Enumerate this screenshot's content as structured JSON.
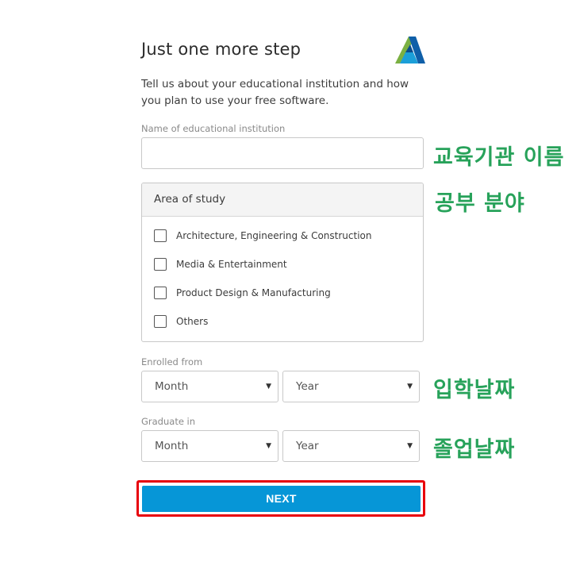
{
  "header": {
    "title": "Just one more step",
    "intro": "Tell us about your educational institution and how you plan to use your free software.",
    "logo": "autodesk-logo",
    "brand_colors": [
      "#0f5fa8",
      "#1b9fd8",
      "#7bb042"
    ]
  },
  "institution": {
    "label": "Name of educational institution",
    "value": "",
    "annotation": "교육기관 이름"
  },
  "area_of_study": {
    "heading": "Area of study",
    "options": [
      {
        "label": "Architecture, Engineering & Construction",
        "checked": false
      },
      {
        "label": "Media & Entertainment",
        "checked": false
      },
      {
        "label": "Product Design & Manufacturing",
        "checked": false
      },
      {
        "label": "Others",
        "checked": false
      }
    ],
    "annotation": "공부 분야"
  },
  "enrolled": {
    "label": "Enrolled from",
    "month": "Month",
    "year": "Year",
    "annotation": "입학날짜"
  },
  "graduate": {
    "label": "Graduate in",
    "month": "Month",
    "year": "Year",
    "annotation": "졸업날짜"
  },
  "next_button": {
    "label": "NEXT",
    "color": "#0696d7",
    "highlight_color": "#e8000b"
  },
  "annotation_color": "#27a25a"
}
